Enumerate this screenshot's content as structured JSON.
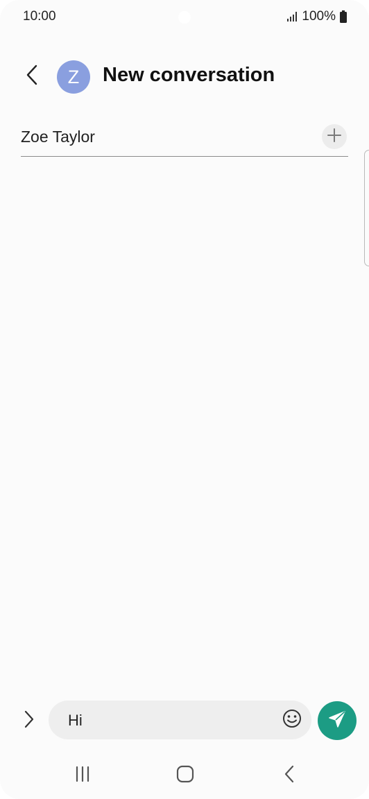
{
  "status_bar": {
    "time": "10:00",
    "battery": "100%",
    "icons": [
      "signal-icon",
      "battery-icon"
    ]
  },
  "header": {
    "back_icon": "chevron-left-icon",
    "avatar_letter": "Z",
    "title": "New conversation"
  },
  "recipient": {
    "name": "Zoe Taylor",
    "add_icon": "plus-icon"
  },
  "composer": {
    "expand_icon": "chevron-right-icon",
    "message": "Hi",
    "emoji_icon": "smiley-icon",
    "send_icon": "send-icon"
  },
  "nav_bar": {
    "icons": [
      "recents-icon",
      "home-icon",
      "back-icon"
    ]
  },
  "colors": {
    "accent": "#1c9c84",
    "avatar": "#8a9fdf",
    "background": "#fbfbfb",
    "input_background": "#eeeeee"
  }
}
